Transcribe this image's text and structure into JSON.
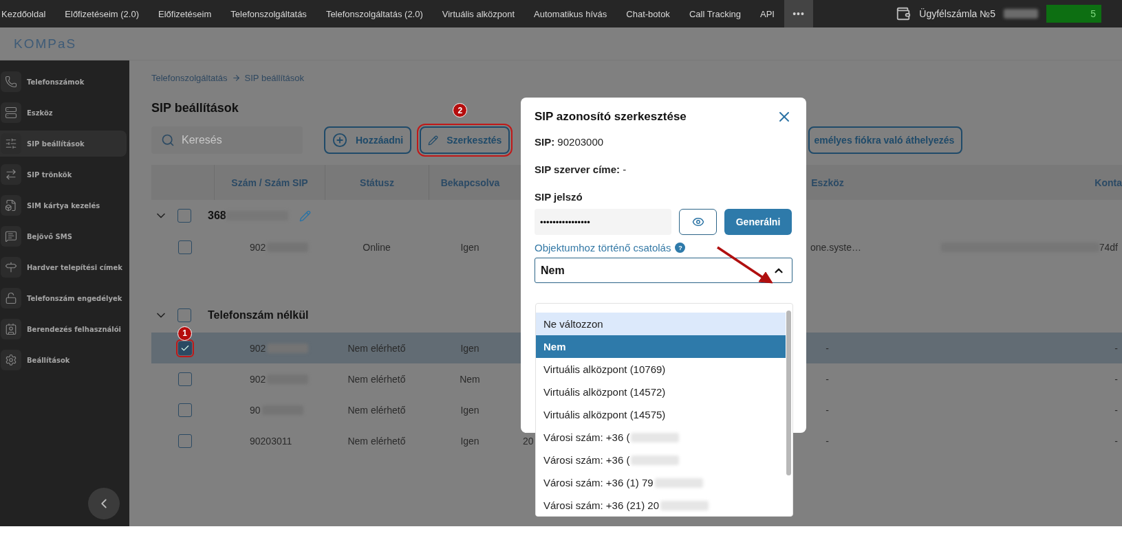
{
  "top_nav": {
    "items": [
      {
        "label": "Kezdőoldal"
      },
      {
        "label": "Előfizetéseim (2.0)"
      },
      {
        "label": "Előfizetéseim"
      },
      {
        "label": "Telefonszolgáltatás"
      },
      {
        "label": "Telefonszolgáltatás (2.0)"
      },
      {
        "label": "Virtuális alközpont"
      },
      {
        "label": "Automatikus hívás"
      },
      {
        "label": "Chat-botok"
      },
      {
        "label": "Call Tracking"
      },
      {
        "label": "API"
      }
    ],
    "more": "•••",
    "account_label": "Ügyfélszámla №5",
    "balance": "5"
  },
  "logo": "KOMPaS",
  "sidebar": {
    "items": [
      {
        "label": "Telefonszámok",
        "selected": false
      },
      {
        "label": "Eszköz",
        "selected": false
      },
      {
        "label": "SIP beállítások",
        "selected": true
      },
      {
        "label": "SIP trönkök",
        "selected": false
      },
      {
        "label": "SIM kártya kezelés",
        "selected": false
      },
      {
        "label": "Bejövő SMS",
        "selected": false
      },
      {
        "label": "Hardver telepítési címek",
        "selected": false
      },
      {
        "label": "Telefonszám engedélyek",
        "selected": false
      },
      {
        "label": "Berendezés felhasználói",
        "selected": false
      },
      {
        "label": "Beállítások",
        "selected": false
      }
    ]
  },
  "breadcrumb": [
    "Telefonszolgáltatás",
    "SIP beállítások"
  ],
  "page_title": "SIP beállítások",
  "toolbar": {
    "search": {
      "placeholder": "Keresés"
    },
    "buttons": [
      {
        "label": "Hozzáadni",
        "kind": "add",
        "annotation": false
      },
      {
        "label": "Szerkesztés",
        "kind": "edit",
        "annotation": true,
        "marker": "2"
      },
      {
        "label": "emélyes fiókra való áthelyezés",
        "kind": "plain",
        "annotation": false
      }
    ]
  },
  "table": {
    "columns": [
      "Szám / Szám SIP",
      "Státusz",
      "Bekapcsolva",
      "Eszköz",
      "Konta"
    ],
    "groups": [
      {
        "title": "368",
        "expanded": true,
        "checked": false,
        "editable": true,
        "rows": [
          {
            "number": "902",
            "status": "Online",
            "enabled": "Igen",
            "device": "one.syste…",
            "contact": "74df",
            "checked": false,
            "selected": false
          }
        ]
      },
      {
        "title": "Telefonszám nélkül",
        "expanded": true,
        "checked": false,
        "editable": false,
        "rows": [
          {
            "number": "902",
            "status": "Nem elérhető",
            "enabled": "Igen",
            "device": "-",
            "contact": "-",
            "checked": true,
            "selected": true,
            "marker": "1"
          },
          {
            "number": "902",
            "status": "Nem elérhető",
            "enabled": "Nem",
            "device": "-",
            "contact": "-",
            "checked": false,
            "selected": false
          },
          {
            "number": "90",
            "status": "Nem elérhető",
            "enabled": "Igen",
            "device": "-",
            "contact": "-",
            "checked": false,
            "selected": false
          },
          {
            "number": "90203011",
            "status": "Nem elérhető",
            "enabled": "Igen",
            "column_5": "20",
            "device": "-",
            "contact": "-",
            "checked": false,
            "selected": false
          }
        ]
      }
    ]
  },
  "modal": {
    "title": "SIP azonosító szerkesztése",
    "sip_label": "SIP:",
    "sip_value": "90203000",
    "server_label": "SIP szerver címe:",
    "server_value": "-",
    "password_label": "SIP jelszó",
    "password_value": "••••••••••••••••",
    "generate_button": "Generálni",
    "link_label": "Objektumhoz történő csatolás",
    "help_badge": "?",
    "select": {
      "value": "Nem",
      "expanded": true,
      "annotation_arrow": true,
      "options": [
        {
          "label": "Ne változzon",
          "selected": false,
          "hovered": true
        },
        {
          "label": "Nem",
          "selected": true,
          "hovered": false
        },
        {
          "label": "Virtuális alközpont (10769)",
          "selected": false,
          "hovered": false
        },
        {
          "label": "Virtuális alközpont (14572)",
          "selected": false,
          "hovered": false
        },
        {
          "label": "Virtuális alközpont (14575)",
          "selected": false,
          "hovered": false
        },
        {
          "label": "Városi szám: +36 (",
          "selected": false,
          "hovered": false
        },
        {
          "label": "Városi szám: +36 (",
          "selected": false,
          "hovered": false
        },
        {
          "label": "Városi szám: +36 (1) 79",
          "selected": false,
          "hovered": false
        },
        {
          "label": "Városi szám: +36 (21) 20",
          "selected": false,
          "hovered": false
        }
      ]
    }
  }
}
